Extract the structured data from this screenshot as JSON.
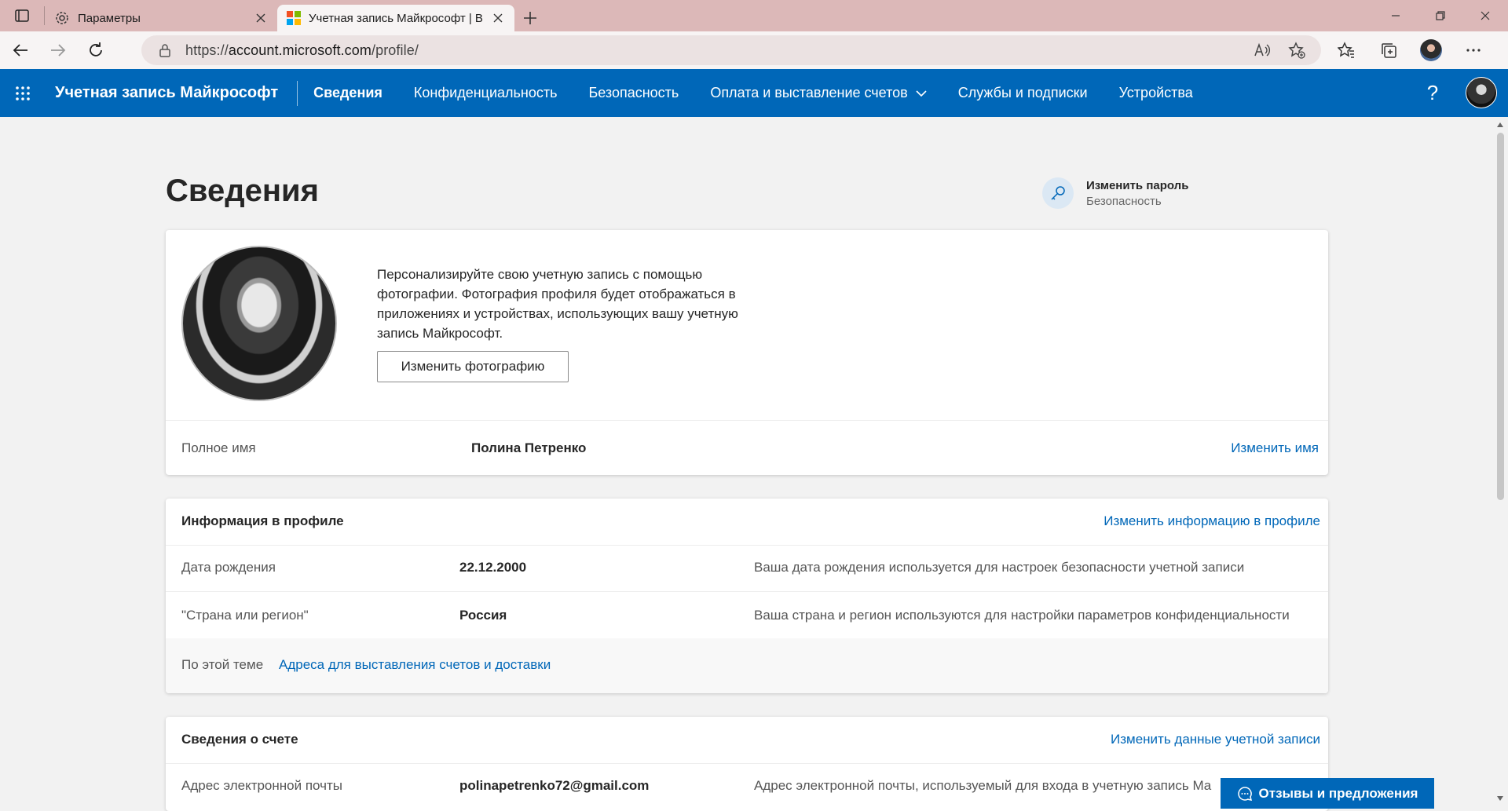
{
  "browser": {
    "tabs": [
      {
        "title": "Параметры",
        "active": false
      },
      {
        "title": "Учетная запись Майкрософт | В",
        "active": true
      }
    ],
    "url_prefix": "https://",
    "url_host": "account.microsoft.com",
    "url_path": "/profile/"
  },
  "nav": {
    "brand": "Учетная запись Майкрософт",
    "links": [
      "Сведения",
      "Конфиденциальность",
      "Безопасность",
      "Оплата и выставление счетов",
      "Службы и подписки",
      "Устройства"
    ],
    "help": "?"
  },
  "page": {
    "title": "Сведения",
    "change_password": "Изменить пароль",
    "change_password_sub": "Безопасность"
  },
  "profile_card": {
    "photo_text": "Персонализируйте свою учетную запись с помощью фотографии. Фотография профиля будет отображаться в приложениях и устройствах, использующих вашу учетную запись Майкрософт.",
    "photo_button": "Изменить фотографию",
    "fullname_label": "Полное имя",
    "fullname_value": "Полина Петренко",
    "edit_name": "Изменить имя"
  },
  "profile_info": {
    "title": "Информация в профиле",
    "edit": "Изменить информацию в профиле",
    "rows": [
      {
        "label": "Дата рождения",
        "value": "22.12.2000",
        "desc": "Ваша дата рождения используется для настроек безопасности учетной записи"
      },
      {
        "label": "\"Страна или регион\"",
        "value": "Россия",
        "desc": "Ваша страна и регион используются для настройки параметров конфиденциальности"
      }
    ],
    "related_label": "По этой теме",
    "related_link": "Адреса для выставления счетов и доставки"
  },
  "account_info": {
    "title": "Сведения о счете",
    "edit": "Изменить данные учетной записи",
    "email_label": "Адрес электронной почты",
    "email_value": "polinapetrenko72@gmail.com",
    "email_desc": "Адрес электронной почты, используемый для входа в учетную запись Ма"
  },
  "feedback": "Отзывы и предложения",
  "colors": {
    "brand": "#0067b8",
    "titlebar": "#dcb8b8"
  }
}
